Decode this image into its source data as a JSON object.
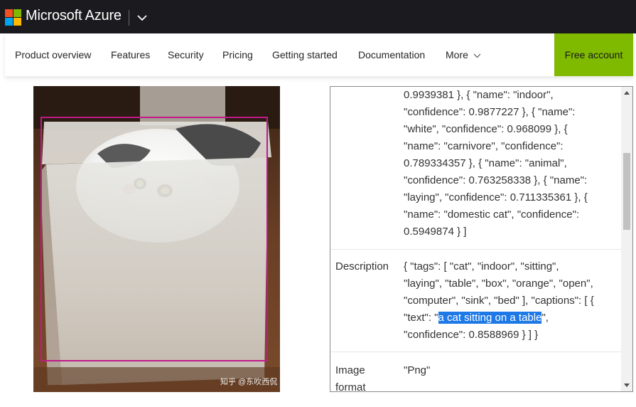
{
  "header": {
    "brand": "Microsoft Azure",
    "logo_colors": [
      "#f25022",
      "#7fba00",
      "#00a4ef",
      "#ffb900"
    ]
  },
  "nav": {
    "items": [
      "Product overview",
      "Features",
      "Security",
      "Pricing",
      "Getting started",
      "Documentation",
      "More"
    ],
    "cta": "Free account"
  },
  "image": {
    "watermark": "知乎 @东吹西侃",
    "detection_color": "#c2188b"
  },
  "results": {
    "tags_lines": [
      "0.9939381 }, { \"name\": \"indoor\",",
      "\"confidence\": 0.9877227 }, { \"name\":",
      "\"white\", \"confidence\": 0.968099 }, {",
      "\"name\": \"carnivore\", \"confidence\":",
      "0.789334357 }, { \"name\": \"animal\",",
      "\"confidence\": 0.763258338 }, { \"name\":",
      "\"laying\", \"confidence\": 0.711335361 }, {",
      "\"name\": \"domestic cat\", \"confidence\":",
      "0.5949874 } ]"
    ],
    "description": {
      "label": "Description",
      "lines": [
        "{ \"tags\": [ \"cat\", \"indoor\", \"sitting\",",
        "\"laying\", \"table\", \"box\", \"orange\", \"open\",",
        "\"computer\", \"sink\", \"bed\" ], \"captions\": [ {"
      ],
      "caption_prefix": "\"text\": \"",
      "caption_highlight": "a cat sitting on a table",
      "caption_suffix": "\",",
      "last_line": "\"confidence\": 0.8588969 } ] }"
    },
    "image_format": {
      "label_line1": "Image",
      "label_line2": "format",
      "value": "\"Png\""
    }
  }
}
